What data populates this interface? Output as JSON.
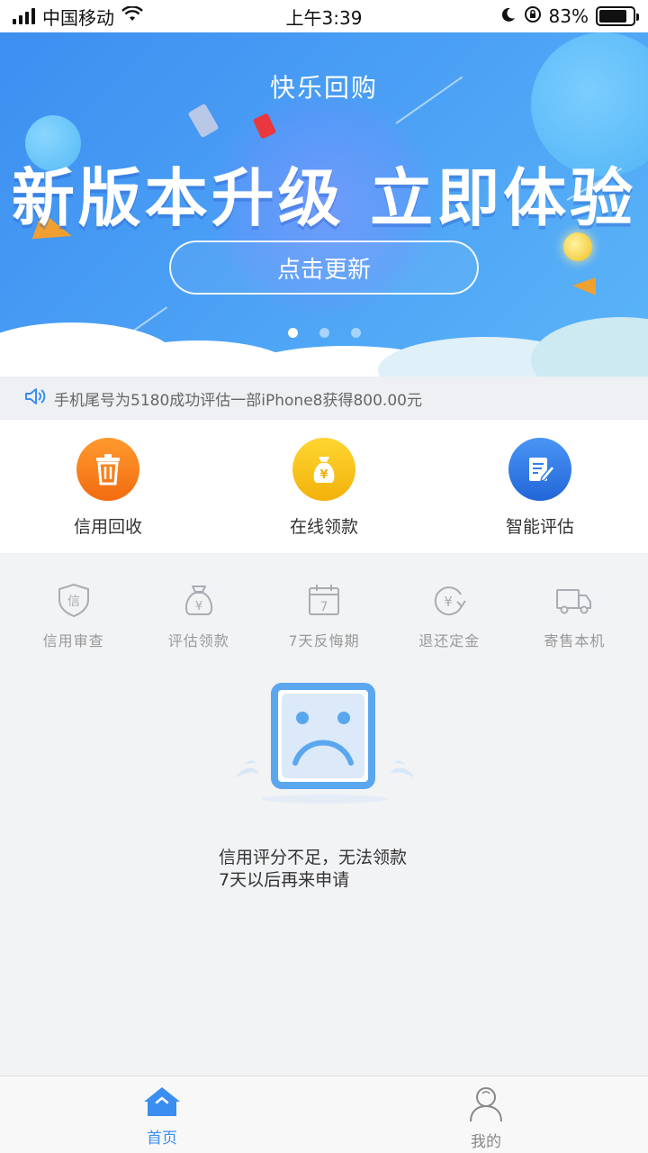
{
  "status_bar": {
    "carrier": "中国移动",
    "time": "上午3:39",
    "battery": "83%",
    "battery_level": 0.83
  },
  "banner": {
    "subtitle": "快乐回购",
    "title": "新版本升级 立即体验",
    "button_label": "点击更新",
    "page_count": 3,
    "active_page": 0
  },
  "notice": {
    "text": "手机尾号为5180成功评估一部iPhone8获得800.00元"
  },
  "features": [
    {
      "label": "信用回收",
      "icon": "trash-icon",
      "color": "#f5821f"
    },
    {
      "label": "在线领款",
      "icon": "money-bag-icon",
      "color": "#f6c019"
    },
    {
      "label": "智能评估",
      "icon": "edit-note-icon",
      "color": "#2f7ee8"
    }
  ],
  "subfeatures": [
    {
      "label": "信用审查",
      "icon": "credit-shield-icon"
    },
    {
      "label": "评估领款",
      "icon": "money-bag-outline-icon"
    },
    {
      "label": "7天反悔期",
      "icon": "calendar-7-icon"
    },
    {
      "label": "退还定金",
      "icon": "yen-refund-icon"
    },
    {
      "label": "寄售本机",
      "icon": "delivery-truck-icon"
    }
  ],
  "empty_state": {
    "line1": "信用评分不足，无法领款",
    "line2": "7天以后再来申请",
    "icon": "sad-face-icon"
  },
  "tabbar": {
    "items": [
      {
        "label": "首页",
        "icon": "home-icon",
        "active": true
      },
      {
        "label": "我的",
        "icon": "user-icon",
        "active": false
      }
    ]
  },
  "colors": {
    "accent": "#3a8ef0",
    "banner_blue": "#4a9ff5"
  }
}
